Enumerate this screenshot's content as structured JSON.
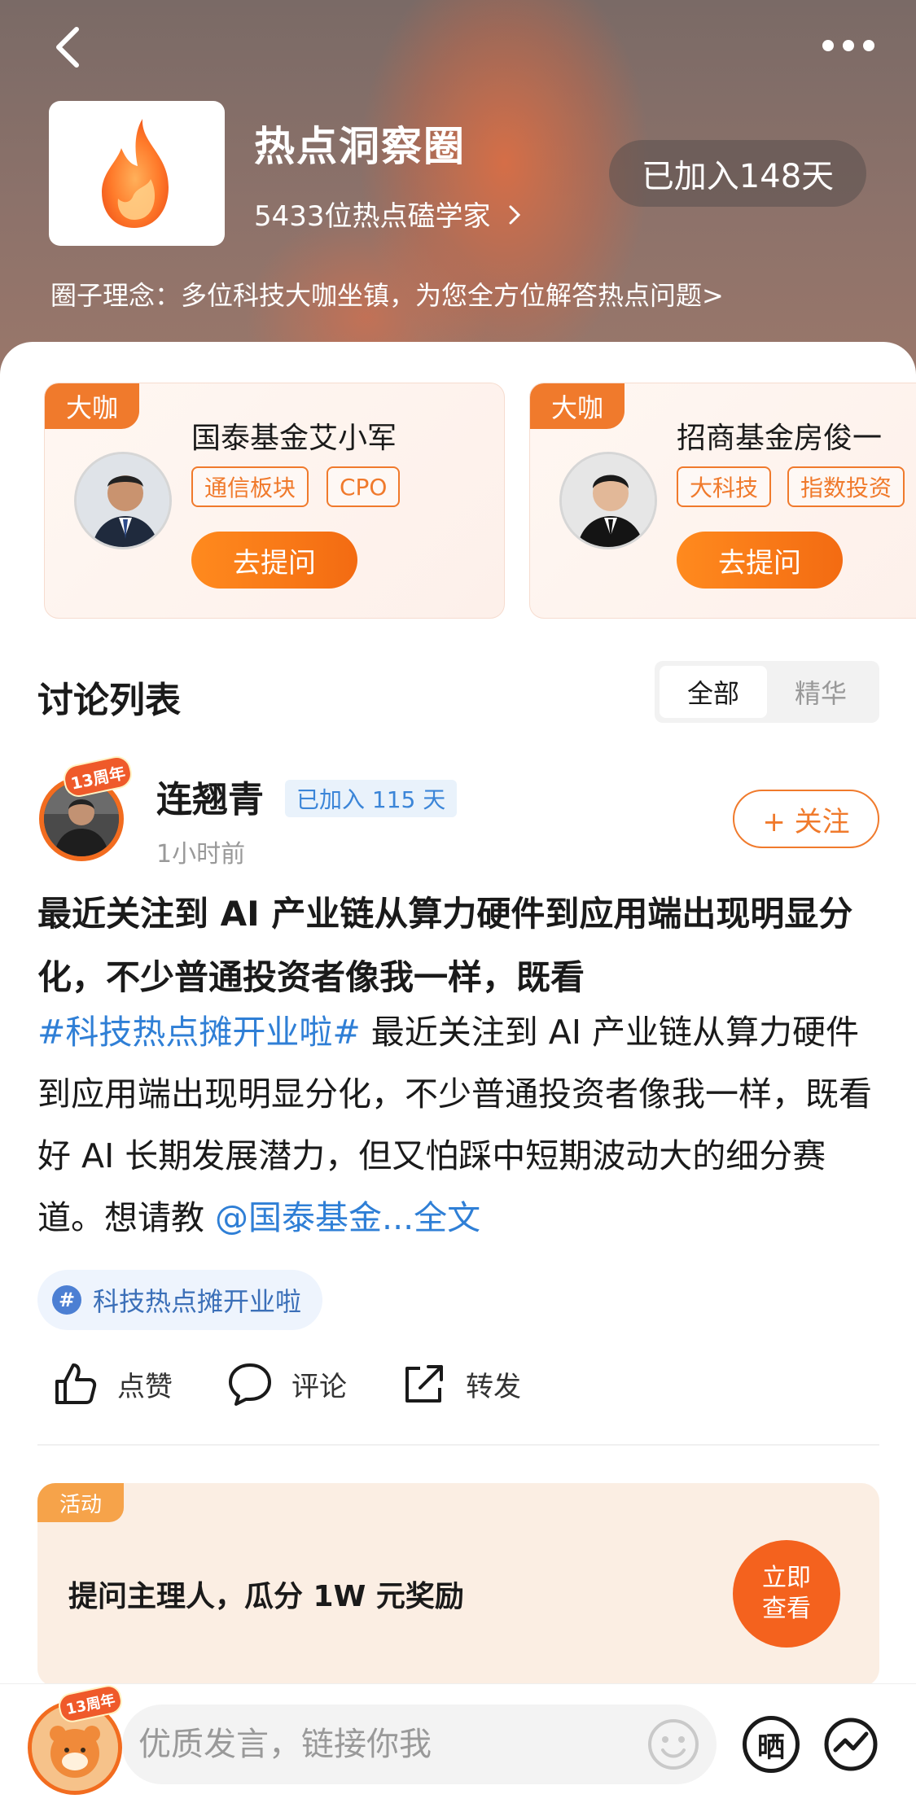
{
  "header": {
    "circle_title": "热点洞察圈",
    "member_count": "5433位热点磕学家",
    "joined_days": "已加入148天",
    "circle_idea": "圈子理念：多位科技大咖坐镇，为您全方位解答热点问题>"
  },
  "experts": [
    {
      "tag": "大咖",
      "name": "国泰基金艾小军",
      "topics": [
        "通信板块",
        "CPO"
      ],
      "ask_label": "去提问"
    },
    {
      "tag": "大咖",
      "name": "招商基金房俊一",
      "topics": [
        "大科技",
        "指数投资"
      ],
      "ask_label": "去提问"
    }
  ],
  "discussion": {
    "title": "讨论列表",
    "tabs": [
      "全部",
      "精华"
    ],
    "active_tab": "全部"
  },
  "post": {
    "author": "连翘青",
    "author_badge": "13周年",
    "joined": "已加入 115 天",
    "time": "1小时前",
    "follow_label": "+ 关注",
    "title": "最近关注到 AI 产业链从算力硬件到应用端出现明显分化，不少普通投资者像我一样，既看",
    "hashtag": "#科技热点摊开业啦#",
    "body": " 最近关注到 AI 产业链从算力硬件到应用端出现明显分化，不少普通投资者像我一样，既看好 AI 长期发展潜力，但又怕踩中短期波动大的细分赛道。想请教 ",
    "mention": "@国泰基金...",
    "full_text": "全文",
    "topic_chip": "科技热点摊开业啦",
    "actions": {
      "like": "点赞",
      "comment": "评论",
      "share": "转发"
    }
  },
  "activity": {
    "tag": "活动",
    "text": "提问主理人，瓜分 1W 元奖励",
    "button": "立即查看"
  },
  "bottom_bar": {
    "me_badge": "13周年",
    "placeholder": "优质发言，链接你我",
    "share_glyph": "晒"
  },
  "colors": {
    "accent": "#f07a2c",
    "link": "#2f7fd6",
    "activity_bg": "#fbeee3"
  }
}
